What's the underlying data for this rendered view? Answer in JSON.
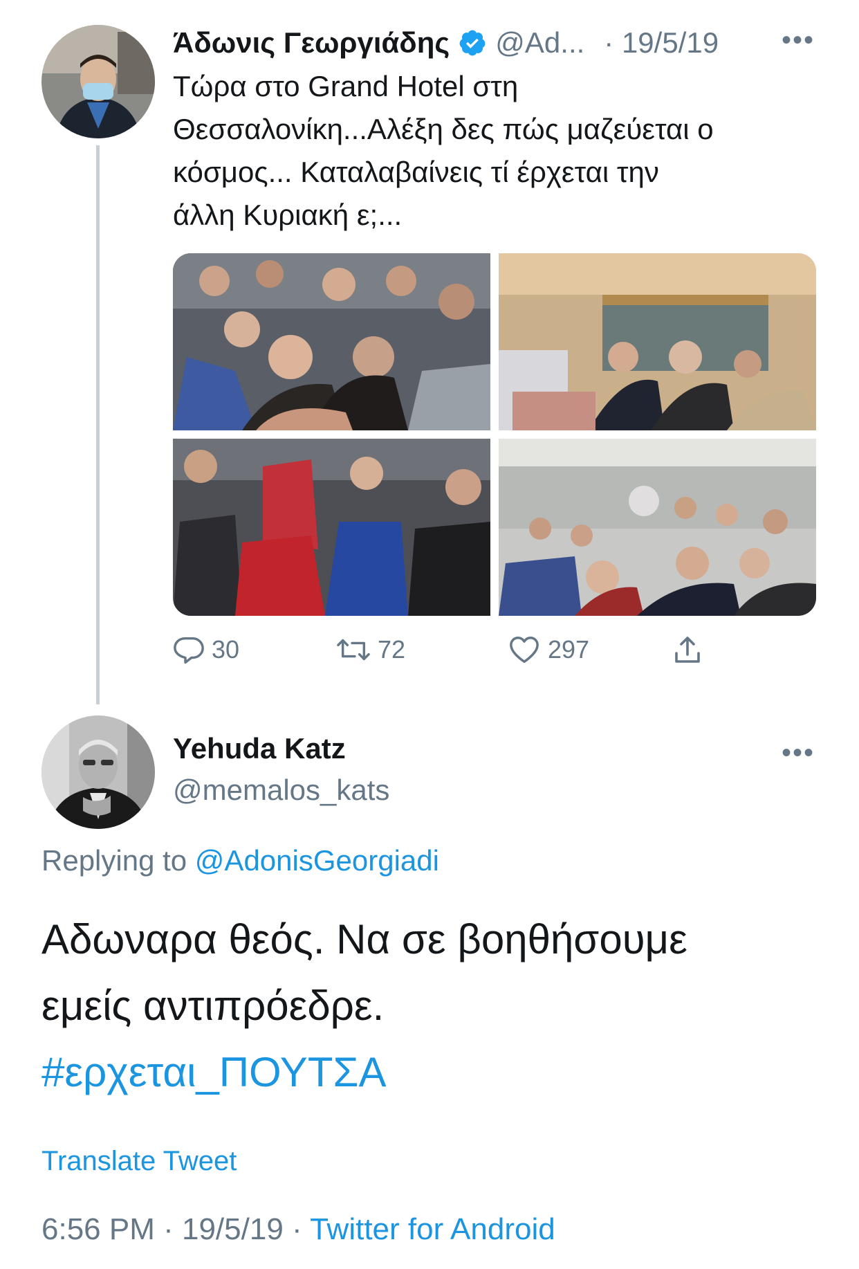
{
  "tweet": {
    "author_name": "Άδωνις Γεωργιάδης",
    "handle": "@Ad...",
    "date": "· 19/5/19",
    "text_lines": [
      "Τώρα στο Grand Hotel στη",
      "Θεσσαλονίκη...Αλέξη δες πώς μαζεύεται ο",
      "κόσμος... Καταλαβαίνεις τί έρχεται την",
      "άλλη Κυριακή ε;..."
    ],
    "replies": "30",
    "retweets": "72",
    "likes": "297"
  },
  "reply": {
    "author_name": "Yehuda Katz",
    "handle": "@memalos_kats",
    "replying_label": "Replying to",
    "replying_to": "@AdonisGeorgiadi",
    "text_lines": [
      "Αδωναρα θεός. Να σε βοηθήσουμε",
      "εμείς αντιπρόεδρε."
    ],
    "hashtag": "#ερχεται_ΠΟΥΤΣΑ",
    "translate": "Translate Tweet",
    "time": "6:56 PM",
    "date": "· 19/5/19 ·",
    "source": "Twitter for Android"
  },
  "colors": {
    "link": "#1b95e0",
    "muted": "#657786",
    "verified": "#1da1f2"
  },
  "icons": [
    "verified-badge-icon",
    "more-icon",
    "reply-icon",
    "retweet-icon",
    "like-icon",
    "share-icon"
  ]
}
